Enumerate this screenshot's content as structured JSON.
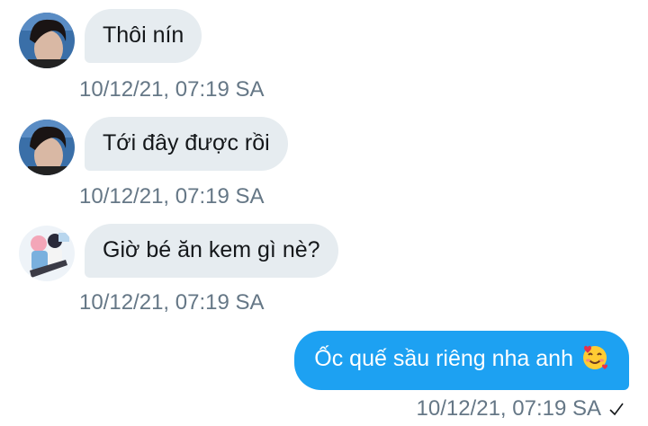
{
  "messages": [
    {
      "id": 1,
      "direction": "incoming",
      "avatar": "male-portrait-avatar",
      "text": "Thôi nín",
      "timestamp": "10/12/21, 07:19 SA"
    },
    {
      "id": 2,
      "direction": "incoming",
      "avatar": "male-portrait-avatar",
      "text": "Tới đây được rồi",
      "timestamp": "10/12/21, 07:19 SA"
    },
    {
      "id": 3,
      "direction": "incoming",
      "avatar": "couple-illustration-avatar",
      "text": "Giờ bé ăn kem gì nè?",
      "timestamp": "10/12/21, 07:19 SA"
    },
    {
      "id": 4,
      "direction": "outgoing",
      "text": "Ốc quế sầu riêng nha anh",
      "emoji": "smiling-face-with-hearts",
      "timestamp": "10/12/21, 07:19 SA",
      "status_icon": "check-icon"
    }
  ],
  "colors": {
    "incoming_bubble": "#e6ecf0",
    "outgoing_bubble": "#1da1f2",
    "timestamp": "#657786",
    "text": "#14171a"
  }
}
